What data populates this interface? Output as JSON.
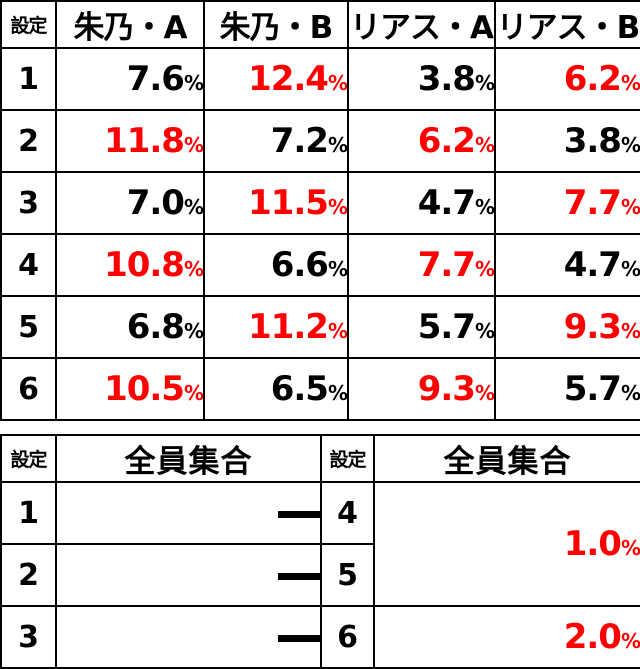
{
  "table1": {
    "headers": [
      "設定",
      "朱乃・A",
      "朱乃・B",
      "リアス・A",
      "リアス・B"
    ],
    "rows": [
      {
        "setting": "1",
        "values": [
          {
            "num": "7.6",
            "pct": "%",
            "color": "black"
          },
          {
            "num": "12.4",
            "pct": "%",
            "color": "red"
          },
          {
            "num": "3.8",
            "pct": "%",
            "color": "black"
          },
          {
            "num": "6.2",
            "pct": "%",
            "color": "red"
          }
        ]
      },
      {
        "setting": "2",
        "values": [
          {
            "num": "11.8",
            "pct": "%",
            "color": "red"
          },
          {
            "num": "7.2",
            "pct": "%",
            "color": "black"
          },
          {
            "num": "6.2",
            "pct": "%",
            "color": "red"
          },
          {
            "num": "3.8",
            "pct": "%",
            "color": "black"
          }
        ]
      },
      {
        "setting": "3",
        "values": [
          {
            "num": "7.0",
            "pct": "%",
            "color": "black"
          },
          {
            "num": "11.5",
            "pct": "%",
            "color": "red"
          },
          {
            "num": "4.7",
            "pct": "%",
            "color": "black"
          },
          {
            "num": "7.7",
            "pct": "%",
            "color": "red"
          }
        ]
      },
      {
        "setting": "4",
        "values": [
          {
            "num": "10.8",
            "pct": "%",
            "color": "red"
          },
          {
            "num": "6.6",
            "pct": "%",
            "color": "black"
          },
          {
            "num": "7.7",
            "pct": "%",
            "color": "red"
          },
          {
            "num": "4.7",
            "pct": "%",
            "color": "black"
          }
        ]
      },
      {
        "setting": "5",
        "values": [
          {
            "num": "6.8",
            "pct": "%",
            "color": "black"
          },
          {
            "num": "11.2",
            "pct": "%",
            "color": "red"
          },
          {
            "num": "5.7",
            "pct": "%",
            "color": "black"
          },
          {
            "num": "9.3",
            "pct": "%",
            "color": "red"
          }
        ]
      },
      {
        "setting": "6",
        "values": [
          {
            "num": "10.5",
            "pct": "%",
            "color": "red"
          },
          {
            "num": "6.5",
            "pct": "%",
            "color": "black"
          },
          {
            "num": "9.3",
            "pct": "%",
            "color": "red"
          },
          {
            "num": "5.7",
            "pct": "%",
            "color": "black"
          }
        ]
      }
    ]
  },
  "table2": {
    "headers": [
      "設定",
      "全員集合",
      "設定",
      "全員集合"
    ],
    "left_rows": [
      {
        "setting": "1",
        "value": "—"
      },
      {
        "setting": "2",
        "value": "—"
      },
      {
        "setting": "3",
        "value": "—"
      }
    ],
    "right_rows": [
      {
        "setting": "4"
      },
      {
        "setting": "5"
      },
      {
        "setting": "6"
      }
    ],
    "right_values": [
      {
        "num": "1.0",
        "pct": "%",
        "color": "red",
        "span": 2
      },
      {
        "num": "2.0",
        "pct": "%",
        "color": "red",
        "span": 1
      }
    ]
  },
  "colors": {
    "header_name_bg": "#c5c5f5",
    "header_setting_bg": "#d9d9d9",
    "highlight": "#ff0000",
    "text": "#000000",
    "border": "#000000",
    "background": "#ffffff"
  }
}
